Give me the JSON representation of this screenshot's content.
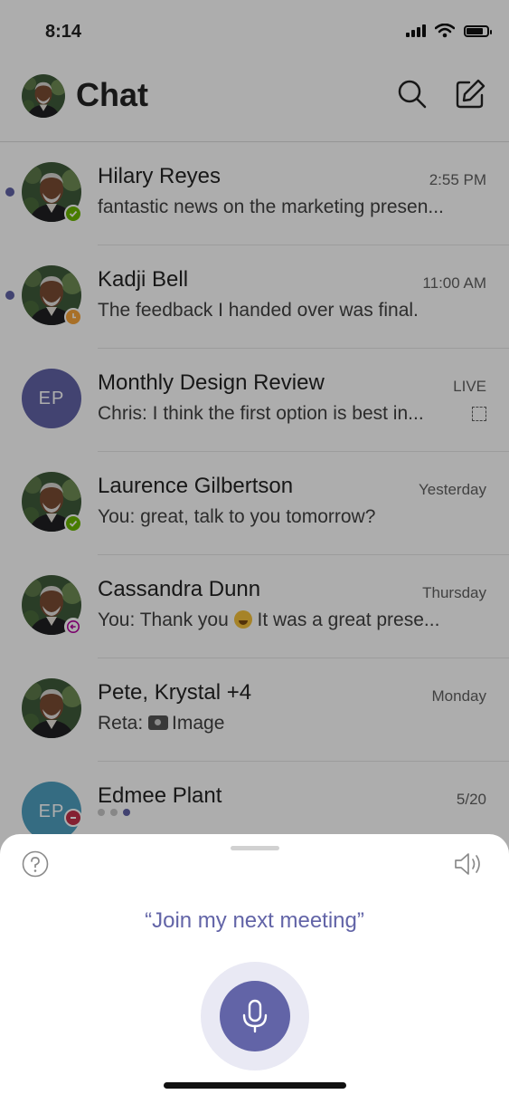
{
  "status_bar": {
    "time": "8:14",
    "icons": [
      "signal-icon",
      "wifi-icon",
      "battery-icon"
    ]
  },
  "header": {
    "title": "Chat",
    "icons": [
      "search-icon",
      "compose-icon"
    ]
  },
  "chats": [
    {
      "name": "Hilary Reyes",
      "time": "2:55 PM",
      "preview": "fantastic news on the marketing presen...",
      "unread": true,
      "presence": "available"
    },
    {
      "name": "Kadji Bell",
      "time": "11:00 AM",
      "preview": "The feedback I handed over was final.",
      "unread": true,
      "presence": "away"
    },
    {
      "name": "Monthly Design Review",
      "time": "LIVE",
      "preview": "Chris: I think the first option is best in...",
      "initials": "EP"
    },
    {
      "name": "Laurence Gilbertson",
      "time": "Yesterday",
      "preview": "You: great, talk to you tomorrow?",
      "presence": "available"
    },
    {
      "name": "Cassandra Dunn",
      "time": "Thursday",
      "preview_before": "You: Thank you",
      "preview_after": "It was a great prese...",
      "presence": "out-of-office"
    },
    {
      "name": "Pete, Krystal +4",
      "time": "Monday",
      "preview_before": "Reta:",
      "preview_after": "Image"
    },
    {
      "name": "Edmee Plant",
      "time": "5/20",
      "initials": "EP",
      "presence": "busy"
    }
  ],
  "voice_sheet": {
    "suggestion": "“Join my next meeting”",
    "icons": [
      "help-icon",
      "speaker-icon",
      "microphone-icon"
    ]
  },
  "colors": {
    "accent": "#6264a7",
    "available": "#6bb700",
    "away": "#f8a63c",
    "out_of_office": "#b4009e",
    "busy": "#c4314b",
    "edmee_avatar": "#4f9fc0"
  }
}
